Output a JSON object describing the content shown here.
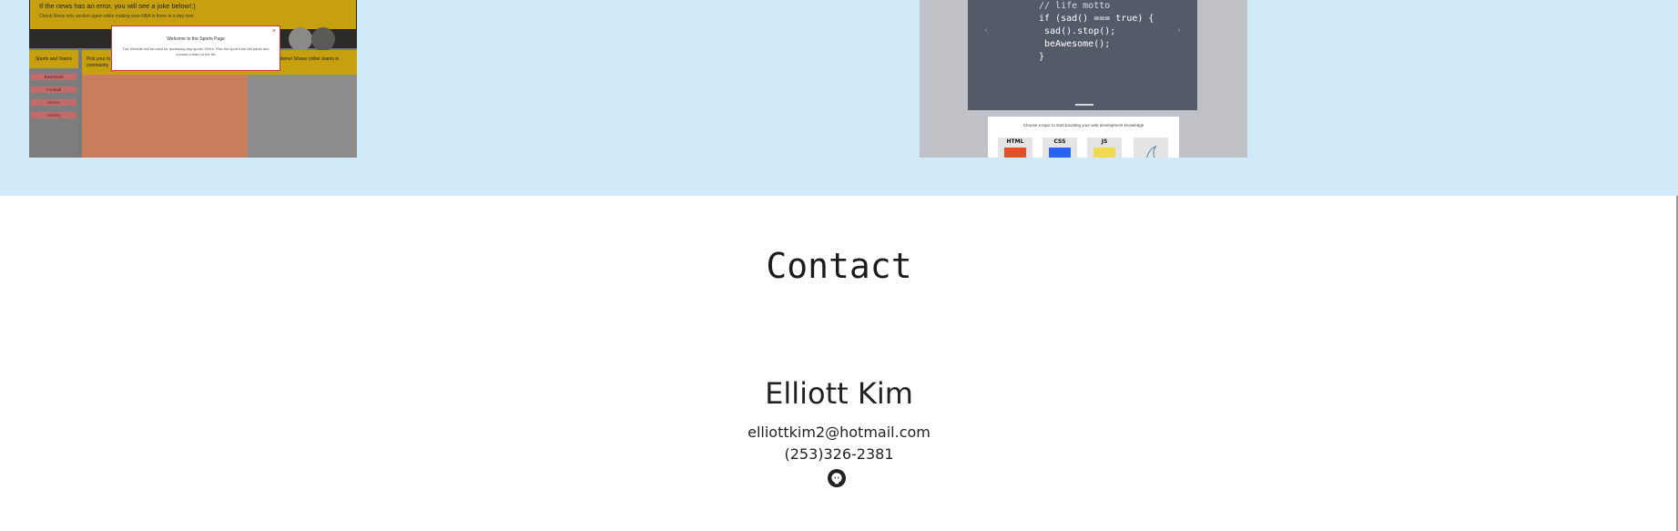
{
  "projects": {
    "left": {
      "banner_title": "If the news has an error, you will see a joke below!:)",
      "banner_sub": "Check News only section again while making sure NBA is there in a day new",
      "sidebar_heading": "Sports and Teams",
      "sidebar_items": [
        "Basketball",
        "Football",
        "Soccer",
        "Hockey"
      ],
      "mid_text": "Pick your fa\ncommunity",
      "right_text": "er/Meme/ Shows (other teams in",
      "modal_close": "×",
      "modal_title": "Welcome to the Sports Page",
      "modal_body": "The Website will be used for accessing any sports SPA's. Pick the sport from left panel and choose a team to the list"
    },
    "right": {
      "code_line_1": "// life motto",
      "code_line_2": "if (sad() === true) {",
      "code_line_3": " sad().stop();",
      "code_line_4": " beAwesome();",
      "code_line_5": "}",
      "prev_arrow": "‹",
      "next_arrow": "›",
      "card_text": "Choose a topic to start boosting your web development knowledge",
      "topics": [
        {
          "label": "HTML",
          "color": "#e34f26"
        },
        {
          "label": "CSS",
          "color": "#2965f1"
        },
        {
          "label": "JS",
          "color": "#f0db4f"
        },
        {
          "label": "",
          "color": "#5a8fa8"
        }
      ]
    }
  },
  "contact": {
    "heading": "Contact",
    "name": "Elliott Kim",
    "email": "elliottkim2@hotmail.com",
    "phone": "(253)326-2381",
    "github_icon": "github-icon"
  },
  "colors": {
    "band_bg": "#d1eafa",
    "page_bg": "#ffffff",
    "text": "#222222"
  }
}
